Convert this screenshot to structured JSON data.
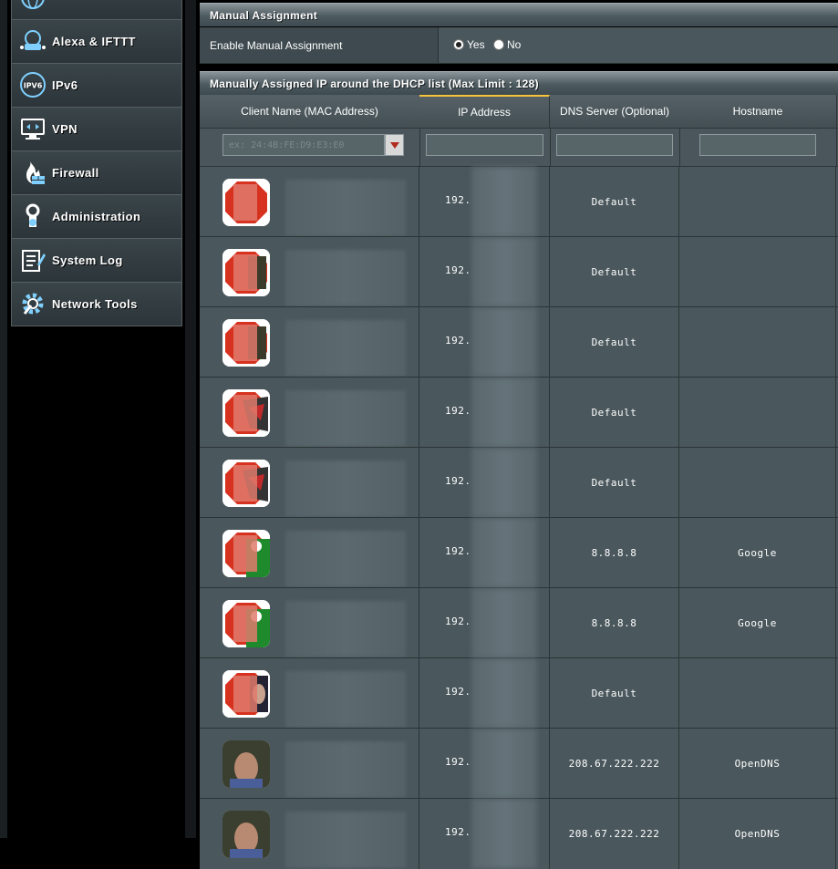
{
  "sidebar": {
    "items": [
      {
        "label": "",
        "icon": "globe-icon"
      },
      {
        "label": "Alexa & IFTTT",
        "icon": "alexa-ifttt-icon"
      },
      {
        "label": "IPv6",
        "icon": "ipv6-icon"
      },
      {
        "label": "VPN",
        "icon": "vpn-icon"
      },
      {
        "label": "Firewall",
        "icon": "firewall-icon"
      },
      {
        "label": "Administration",
        "icon": "administration-icon"
      },
      {
        "label": "System Log",
        "icon": "system-log-icon"
      },
      {
        "label": "Network Tools",
        "icon": "network-tools-icon"
      }
    ]
  },
  "manual": {
    "title": "Manually Assigned IP around the DHCP list (Max Limit : 128)",
    "enable_label": "Enable Manual Assignment",
    "yes_label": "Yes",
    "no_label": "No",
    "selected": "Yes"
  },
  "section_title": "Manual Assignment",
  "table": {
    "headers": {
      "client": "Client Name (MAC Address)",
      "ip": "IP Address",
      "dns": "DNS Server (Optional)",
      "hostname": "Hostname"
    },
    "mac_placeholder": "ex: 24:4B:FE:D9:E3:E0",
    "rows": [
      {
        "ip": "192.",
        "dns": "Default",
        "hostname": "",
        "avatar": "stop-sign-icon"
      },
      {
        "ip": "192.",
        "dns": "Default",
        "hostname": "",
        "avatar": "stop-sign-18-adult-icon"
      },
      {
        "ip": "192.",
        "dns": "Default",
        "hostname": "",
        "avatar": "stop-sign-18-adult-icon"
      },
      {
        "ip": "192.",
        "dns": "Default",
        "hostname": "",
        "avatar": "stop-sign-18-rog-icon"
      },
      {
        "ip": "192.",
        "dns": "Default",
        "hostname": "",
        "avatar": "stop-sign-18-rog-icon"
      },
      {
        "ip": "192.",
        "dns": "8.8.8.8",
        "hostname": "Google",
        "avatar": "stop-sign-18-xbox-icon"
      },
      {
        "ip": "192.",
        "dns": "8.8.8.8",
        "hostname": "Google",
        "avatar": "stop-sign-18-xbox-icon"
      },
      {
        "ip": "192.",
        "dns": "Default",
        "hostname": "",
        "avatar": "stop-sign-photo-icon"
      },
      {
        "ip": "192.",
        "dns": "208.67.222.222",
        "hostname": "OpenDNS",
        "avatar": "person-photo-icon"
      },
      {
        "ip": "192.",
        "dns": "208.67.222.222",
        "hostname": "OpenDNS",
        "avatar": "person-photo-icon"
      }
    ]
  },
  "colors": {
    "panel": "#4a575c",
    "header_gradient_top": "#8a9499",
    "stop_red": "#d7321f",
    "xbox_green": "#1f8a2c"
  }
}
